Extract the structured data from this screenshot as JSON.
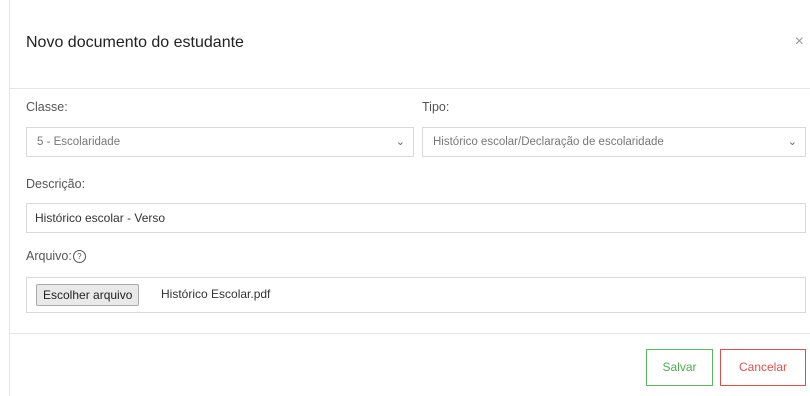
{
  "modal": {
    "title": "Novo documento do estudante",
    "close_glyph": "×"
  },
  "form": {
    "classe": {
      "label": "Classe:",
      "selected": "5 - Escolaridade"
    },
    "tipo": {
      "label": "Tipo:",
      "selected": "Histórico escolar/Declaração de escolaridade"
    },
    "descricao": {
      "label": "Descrição:",
      "value": "Histórico escolar - Verso"
    },
    "arquivo": {
      "label": "Arquivo:",
      "help_icon": "question-circle-icon",
      "help_glyph": "?",
      "button_label": "Escolher arquivo",
      "file_name": "Histórico Escolar.pdf"
    }
  },
  "footer": {
    "save_label": "Salvar",
    "cancel_label": "Cancelar"
  },
  "colors": {
    "save": "#5cb85c",
    "cancel": "#d9534f",
    "border": "#d9d9d9"
  }
}
